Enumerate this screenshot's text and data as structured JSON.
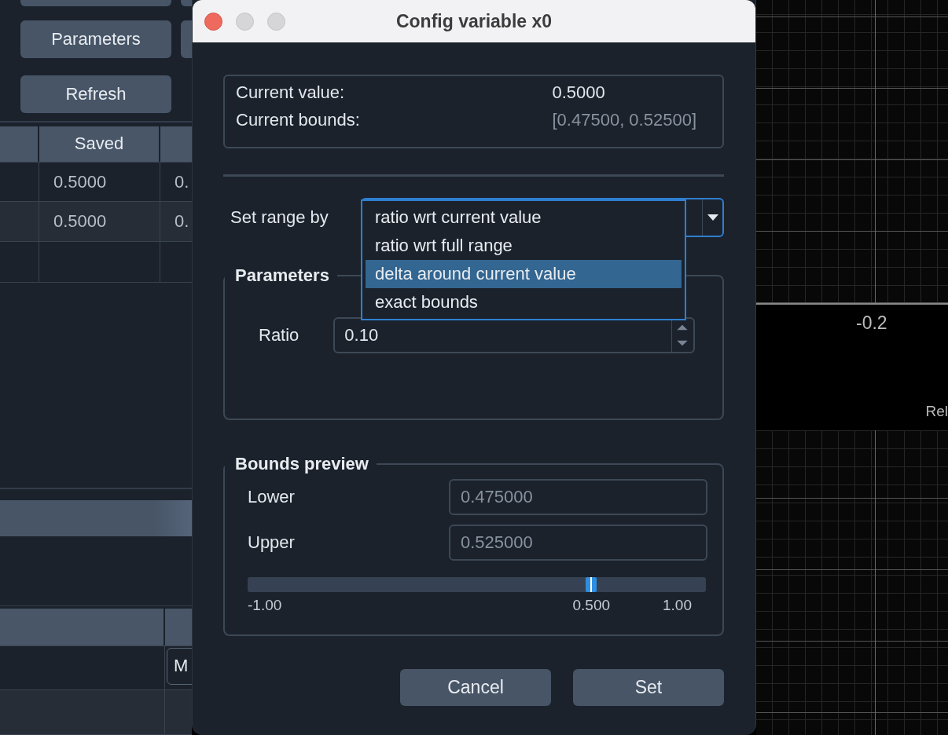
{
  "left_panel": {
    "buttons": [
      {
        "label": "Parameters"
      },
      {
        "label": "Refresh"
      }
    ],
    "saved_table": {
      "header": "Saved",
      "rows": [
        {
          "saved": "0.5000",
          "column_3": "0."
        },
        {
          "saved": "0.5000",
          "column_3": "0."
        }
      ]
    },
    "lower_table": {
      "field": "M"
    }
  },
  "dialog": {
    "title": "Config variable x0",
    "current_value_label": "Current value:",
    "current_value": "0.5000",
    "current_bounds_label": "Current bounds:",
    "current_bounds": "[0.47500, 0.52500]",
    "set_range_label": "Set range by",
    "range_options": [
      {
        "label": "ratio wrt current value",
        "selected": false
      },
      {
        "label": "ratio wrt full range",
        "selected": false
      },
      {
        "label": "delta around current value",
        "selected": true
      },
      {
        "label": "exact bounds",
        "selected": false
      }
    ],
    "parameters": {
      "title": "Parameters",
      "ratio_label": "Ratio",
      "ratio": "0.10"
    },
    "bounds_preview": {
      "title": "Bounds preview",
      "lower_label": "Lower",
      "lower": "0.475000",
      "upper_label": "Upper",
      "upper": "0.525000",
      "slider": {
        "level": 0.75,
        "min_label": "-1.00",
        "value_label": "0.500",
        "max_label": "1.00"
      }
    },
    "buttons": [
      "Cancel",
      "Set"
    ]
  },
  "plot": {
    "tick": "-0.2",
    "axis_label": "Rel"
  }
}
